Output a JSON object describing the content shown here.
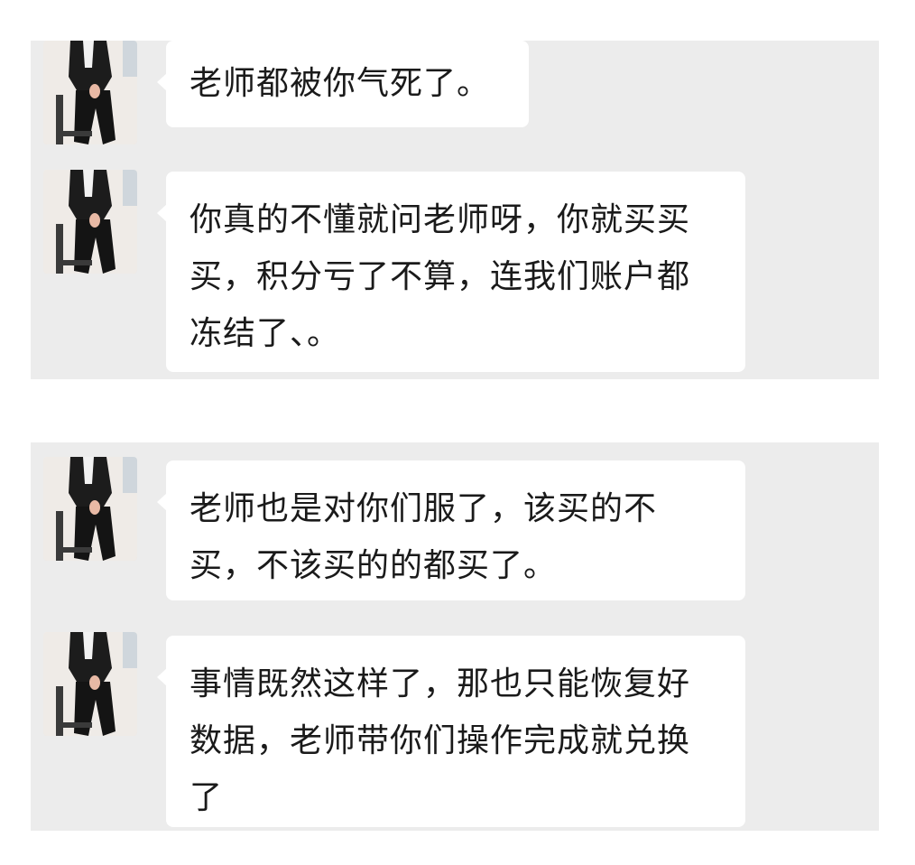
{
  "chat": {
    "panels": [
      {
        "messages": [
          {
            "avatar_icon": "teacher-avatar-icon",
            "text": "老师都被你气死了。"
          },
          {
            "avatar_icon": "teacher-avatar-icon",
            "text": "你真的不懂就问老师呀，你就买买\n买，积分亏了不算，连我们账户都\n冻结了、。"
          }
        ]
      },
      {
        "messages": [
          {
            "avatar_icon": "teacher-avatar-icon",
            "text": "老师也是对你们服了，该买的不\n买，不该买的的都买了。"
          },
          {
            "avatar_icon": "teacher-avatar-icon",
            "text": "事情既然这样了，那也只能恢复好\n数据，老师带你们操作完成就兑换\n了"
          }
        ]
      }
    ]
  },
  "colors": {
    "panel_background": "#ececec",
    "bubble_background": "#ffffff",
    "text": "#1a1a1a"
  }
}
